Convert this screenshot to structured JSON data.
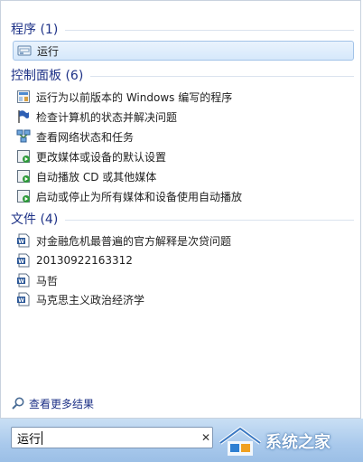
{
  "groups": {
    "programs": {
      "title": "程序 (1)",
      "items": [
        {
          "label": "运行",
          "icon": "run-icon"
        }
      ]
    },
    "control_panel": {
      "title": "控制面板 (6)",
      "items": [
        {
          "label": "运行为以前版本的 Windows 编写的程序",
          "icon": "compatibility-icon"
        },
        {
          "label": "检查计算机的状态并解决问题",
          "icon": "action-center-flag-icon"
        },
        {
          "label": "查看网络状态和任务",
          "icon": "network-icon"
        },
        {
          "label": "更改媒体或设备的默认设置",
          "icon": "autoplay-icon"
        },
        {
          "label": "自动播放 CD 或其他媒体",
          "icon": "autoplay-icon"
        },
        {
          "label": "启动或停止为所有媒体和设备使用自动播放",
          "icon": "autoplay-icon"
        }
      ]
    },
    "files": {
      "title": "文件 (4)",
      "items": [
        {
          "label": "对金融危机最普遍的官方解释是次贷问题",
          "icon": "word-document-icon"
        },
        {
          "label": "20130922163312",
          "icon": "word-document-icon"
        },
        {
          "label": "马哲",
          "icon": "word-document-icon"
        },
        {
          "label": "马克思主义政治经济学",
          "icon": "word-document-icon"
        }
      ]
    }
  },
  "see_more": {
    "label": "查看更多结果",
    "icon": "search-icon"
  },
  "search": {
    "value": "运行",
    "clear_icon": "close-icon"
  },
  "watermark": {
    "text": "系统之家"
  },
  "colors": {
    "group_title": "#1e3287",
    "selection_border": "#a2c3e8",
    "selection_fill": "#dcebfc",
    "bottom_bar": "#b4d0ee"
  }
}
